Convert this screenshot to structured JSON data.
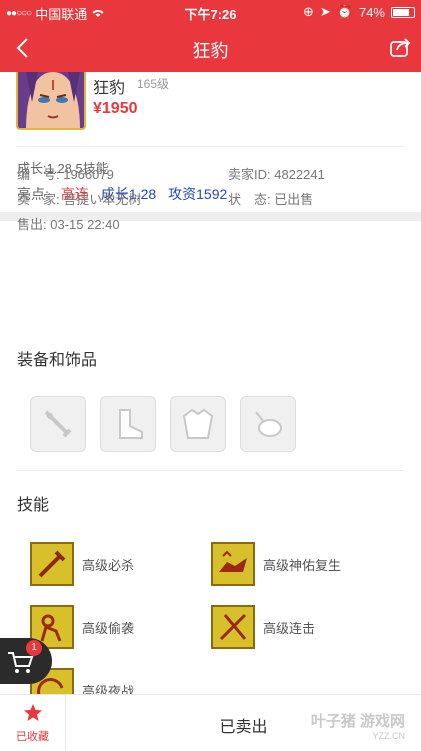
{
  "status_bar": {
    "carrier": "中国联通",
    "time": "下午7:26",
    "battery": "74%"
  },
  "nav": {
    "title": "狂豹"
  },
  "product": {
    "name": "狂豹",
    "level": "165级",
    "price": "¥1950",
    "growth": "成长:1.28 5技能",
    "highlights_label": "亮点:",
    "highlights": [
      "高连",
      "成长1.28",
      "攻资1592"
    ]
  },
  "info": {
    "id": "编　号: 1966079",
    "seller_id": "卖家ID: 4822241",
    "seller": "卖　家: 菩提い本无树",
    "status": "状　态: 已出售",
    "sold_at": "售出: 03-15 22:40"
  },
  "equipment": {
    "title": "装备和饰品",
    "slots": [
      "weapon-icon",
      "boots-icon",
      "armor-icon",
      "accessory-icon"
    ]
  },
  "skills": {
    "title": "技能",
    "items": [
      "高级必杀",
      "高级神佑复生",
      "高级偷袭",
      "高级连击",
      "高级夜战"
    ]
  },
  "cart": {
    "count": "1"
  },
  "bottom": {
    "favorite_label": "已收藏",
    "sold_label": "已卖出",
    "watermark": "叶子猪 游戏网",
    "watermark_url": "YZZ.CN"
  },
  "colors": {
    "brand": "#e8383d",
    "highlight_blue": "#2447b6"
  }
}
